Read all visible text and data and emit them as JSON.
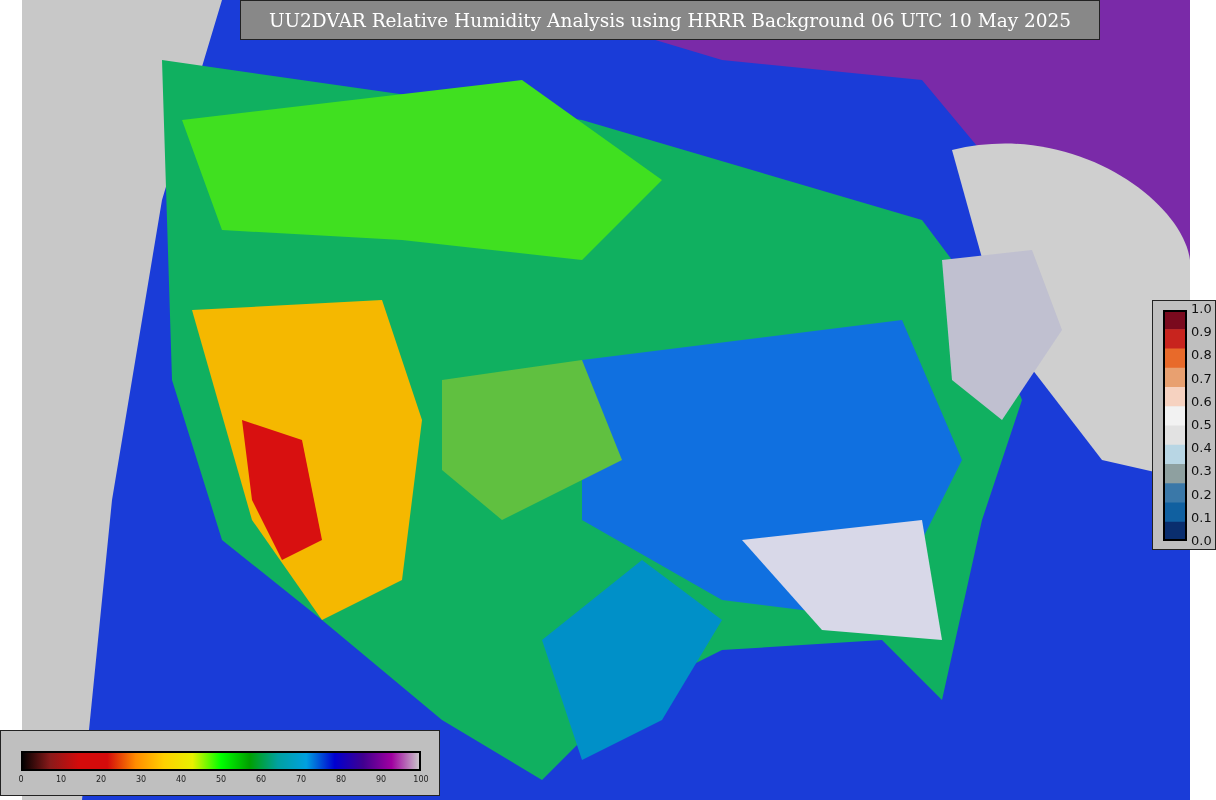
{
  "title": "UU2DVAR Relative Humidity Analysis using HRRR Background 06 UTC 10 May 2025",
  "bottom_colorbar": {
    "ticks": [
      "0",
      "10",
      "20",
      "30",
      "40",
      "50",
      "60",
      "70",
      "80",
      "90",
      "100"
    ]
  },
  "right_colorbar": {
    "ticks": [
      "1.0",
      "0.9",
      "0.8",
      "0.7",
      "0.6",
      "0.5",
      "0.4",
      "0.3",
      "0.2",
      "0.1",
      "0.0"
    ]
  }
}
